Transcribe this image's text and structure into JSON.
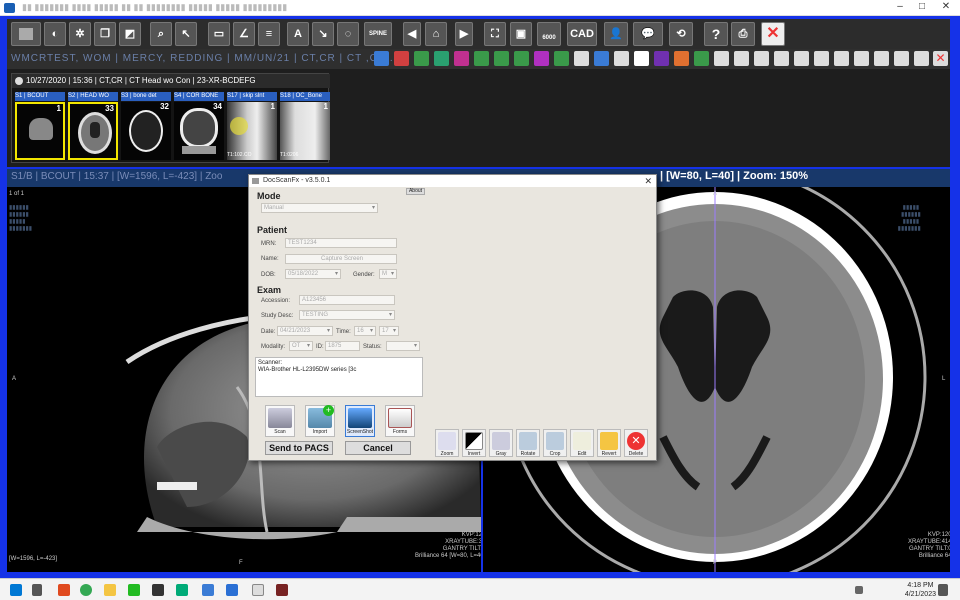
{
  "window": {
    "title": "▮▮ ▮▮▮▮▮▮▮ ▮▮▮▮ ▮▮▮▮▮ ▮▮ ▮▮ ▮▮▮▮▮▮▮▮ ▮▮▮▮▮ ▮▮▮▮▮ ▮▮▮▮▮▮▮▮▮",
    "minimize": "–",
    "maximize": "□",
    "close": "✕"
  },
  "toolbar": {
    "cad_label": "CAD",
    "spine_label": "SPINE",
    "lum_label": "6000"
  },
  "toolbar2": {
    "blurred_text": "WMCRTEST, WOM | MERCY, REDDING | MM/UN/21 | CT,CR | CT ,CR ..."
  },
  "study": {
    "header": "10/27/2020 | 15:36 | CT,CR | CT Head wo Con | 23-XR-BCDEFG"
  },
  "thumbnails": [
    {
      "label": "S1 | BCOUT",
      "count": "1",
      "foot": ""
    },
    {
      "label": "S2 | HEAD WO",
      "count": "33",
      "foot": ""
    },
    {
      "label": "S3 | bone det",
      "count": "32",
      "foot": ""
    },
    {
      "label": "S4 | COR BONE",
      "count": "34",
      "foot": ""
    },
    {
      "label": "S17 | skip slnt",
      "count": "1",
      "foot": "T1:102.CO"
    },
    {
      "label": "S18 | OC_Bone",
      "count": "1",
      "foot": "T1:0206"
    }
  ],
  "viewer": {
    "left_info": "S1/B | BCOUT | 15:37 | [W=1596, L=-423] | Zoo",
    "right_info": "| [W=80, L=40] | Zoom: 150%",
    "left_page": "1 of 1",
    "left_wl": "[W=1596, L=-423]",
    "left_orient_a": "A",
    "left_orient_f": "F",
    "left_tech": "KVP:120\nXRAYTUBE:30\nGANTRY TILT:0\nBrilliance 64 [W=80, L=40]",
    "right_orient_r": "R",
    "right_orient_l": "L",
    "right_orient_a": "A",
    "right_orient_p": "P",
    "right_tech": "KVP:120\nXRAYTUBE:414\nGANTRY TILT:0\nBrilliance 64"
  },
  "dialog": {
    "title": "DocScanFx  -  v3.5.0.1",
    "close": "✕",
    "about": "About",
    "mode_heading": "Mode",
    "mode_value": "Manual",
    "patient_heading": "Patient",
    "mrn_label": "MRN:",
    "mrn_value": "TEST1234",
    "name_label": "Name:",
    "capture_button": "Capture Screen",
    "dob_label": "DOB:",
    "dob_value": "05/18/2022",
    "gender_label": "Gender:",
    "gender_value": "M",
    "exam_heading": "Exam",
    "accession_label": "Accession:",
    "accession_value": "A123456",
    "studydesc_label": "Study Desc:",
    "studydesc_value": "TESTING",
    "date_label": "Date:",
    "date_value": "04/21/2023",
    "time_label": "Time:",
    "time_h": "16",
    "time_m": "17",
    "modality_label": "Modality:",
    "modality_value": "OT",
    "id_label": "ID:",
    "id_value": "1875",
    "status_label": "Status:",
    "scanner_label": "Scanner:",
    "scanner_value": "WIA-Brother HL-L2395DW series [3c",
    "scan_label": "Scan",
    "import_label": "Import",
    "screenshot_label": "ScreenShot",
    "forms_label": "Forms",
    "send_button": "Send to PACS",
    "cancel_button": "Cancel",
    "tools": [
      {
        "label": "Zoom",
        "icon": "magnifier-icon"
      },
      {
        "label": "Invert",
        "icon": "invert-icon"
      },
      {
        "label": "Gray",
        "icon": "gray-icon"
      },
      {
        "label": "Rotate",
        "icon": "rotate-icon"
      },
      {
        "label": "Crop",
        "icon": "crop-icon"
      },
      {
        "label": "Edit",
        "icon": "pencil-icon"
      },
      {
        "label": "Revert",
        "icon": "revert-icon"
      },
      {
        "label": "Delete",
        "icon": "delete-icon"
      }
    ]
  },
  "taskbar": {
    "time": "4:18 PM",
    "date": "4/21/2023"
  }
}
